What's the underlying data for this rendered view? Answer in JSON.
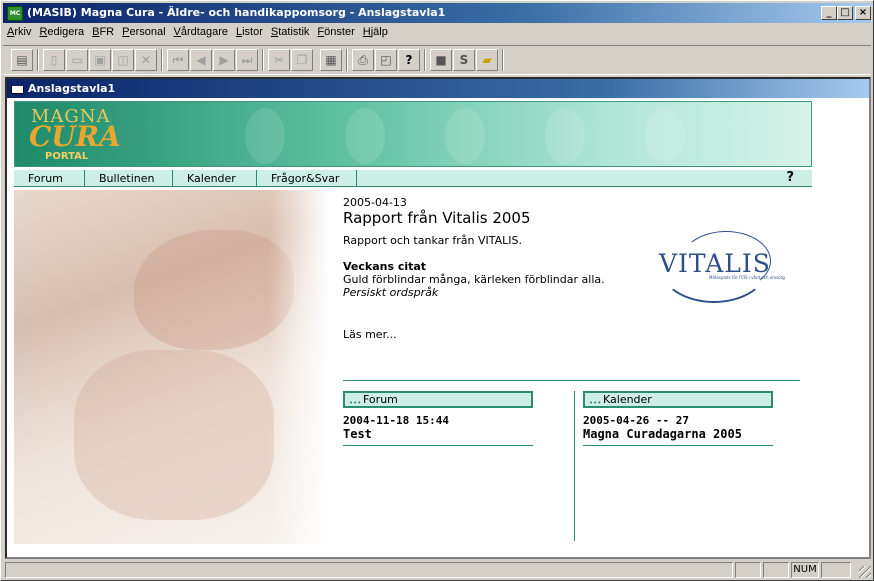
{
  "window": {
    "title": "(MASIB) Magna Cura - Äldre- och handikappomsorg - Anslagstavla1",
    "app_icon": "MC",
    "controls": [
      "minimize",
      "maximize",
      "close"
    ]
  },
  "menu": [
    "Arkiv",
    "Redigera",
    "BFR",
    "Personal",
    "Vårdtagare",
    "Listor",
    "Statistik",
    "Fönster",
    "Hjälp"
  ],
  "toolbar": {
    "buttons": [
      "print-setup-icon",
      "new-icon",
      "open-icon",
      "save-icon",
      "save-all-icon",
      "delete-icon",
      "first-icon",
      "prev-icon",
      "next-icon",
      "last-icon",
      "cut-icon",
      "copy-icon",
      "paste-icon",
      "print-icon",
      "print-preview-icon",
      "help-icon",
      "stop-icon",
      "s-icon",
      "lock-icon"
    ]
  },
  "child_window": {
    "title": "Anslagstavla1"
  },
  "banner": {
    "logo_top": "MAGNA",
    "logo_main": "CURA",
    "logo_sub": "PORTAL"
  },
  "nav": {
    "items": [
      "Forum",
      "Bulletinen",
      "Kalender",
      "Frågor&Svar"
    ],
    "help": "?"
  },
  "article": {
    "date": "2005-04-13",
    "title": "Rapport från Vitalis 2005",
    "summary": "Rapport och tankar från VITALIS.",
    "quote_heading": "Veckans citat",
    "quote_text": "Guld förblindar många, kärleken förblindar alla.",
    "quote_source": "Persiskt ordspråk",
    "read_more": "Läs mer..."
  },
  "vitalis_logo": {
    "text": "VITALIS",
    "subtext": "Mötesplats för IT/IS i vård och omsorg"
  },
  "forum": {
    "label": "Forum",
    "date": "2004-11-18 15:44",
    "title": "Test"
  },
  "calendar": {
    "label": "Kalender",
    "date": "2005-04-26 -- 27",
    "title": "Magna Curadagarna 2005"
  },
  "status": {
    "num": "NUM"
  },
  "colors": {
    "title_blue": "#0a246a",
    "teal": "#2a8f72",
    "mint": "#cdeee5"
  }
}
